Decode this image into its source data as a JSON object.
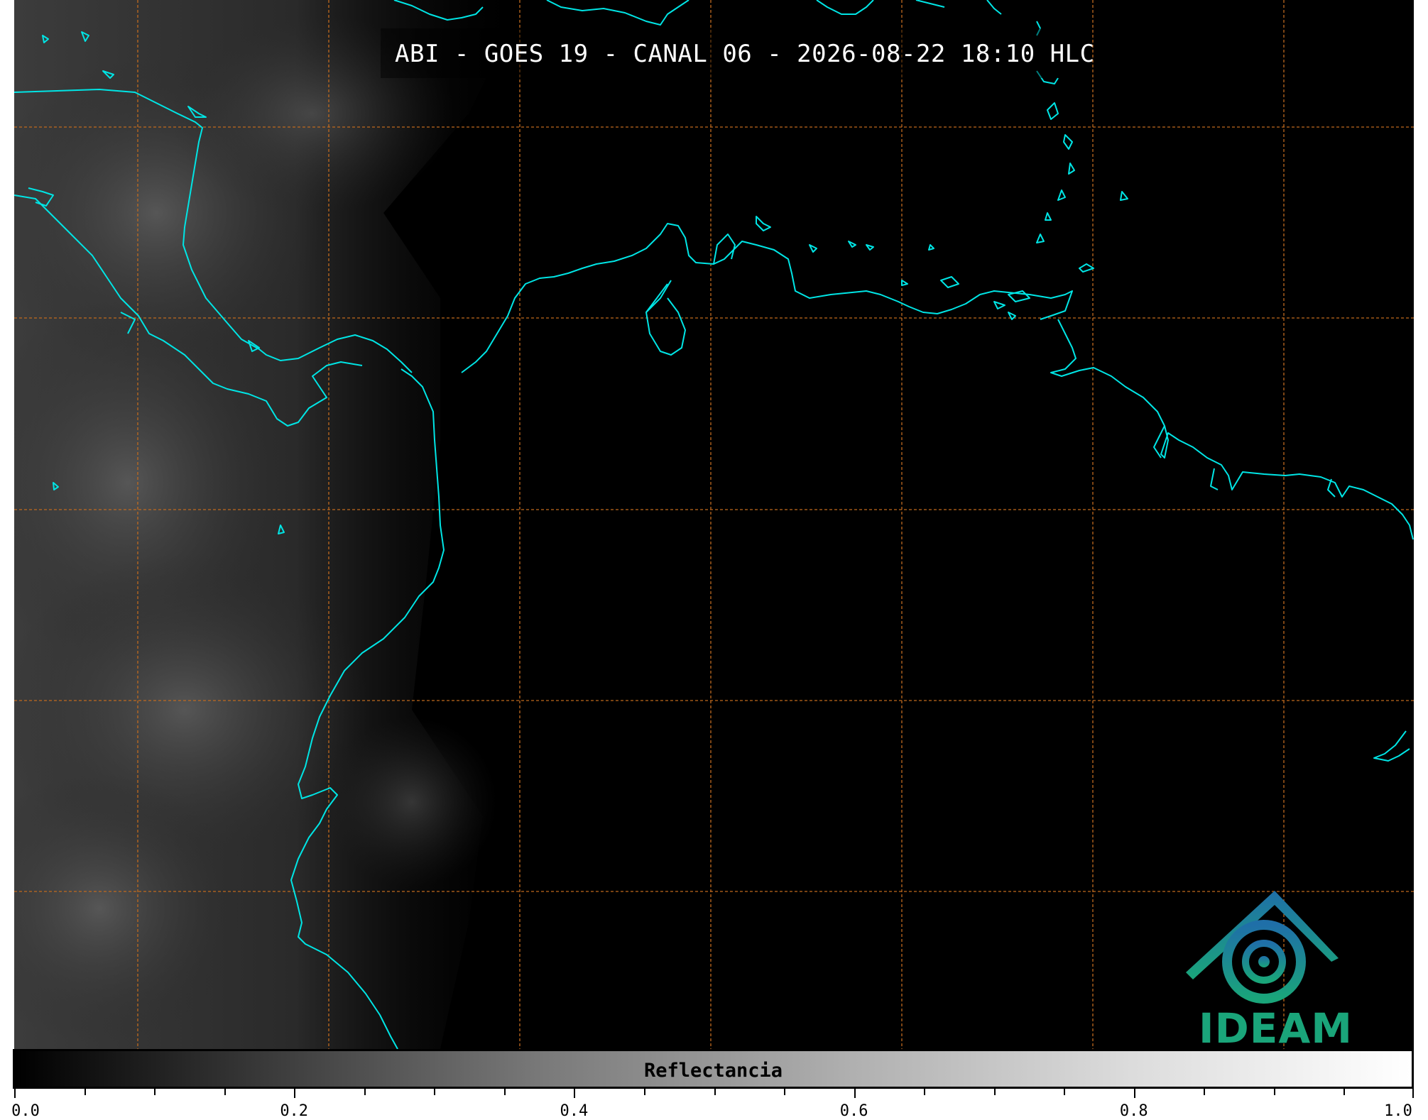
{
  "title": "ABI - GOES 19 - CANAL 06 - 2026-08-22 18:10 HLC",
  "colorbar": {
    "label": "Reflectancia",
    "min": 0.0,
    "max": 1.0,
    "tick_labels": [
      "0.0",
      "0.2",
      "0.4",
      "0.6",
      "0.8",
      "1.0"
    ],
    "minor_tick_step": 0.05,
    "colormap": "greys"
  },
  "logo": {
    "text": "IDEAM"
  },
  "colors": {
    "coastline": "#00e5e5",
    "graticule": "#c06a1e",
    "background": "#000000",
    "logo_green": "#1aa57a",
    "logo_blue": "#1f6fa8"
  },
  "map": {
    "graticule": "dashed",
    "coastlines": true
  }
}
